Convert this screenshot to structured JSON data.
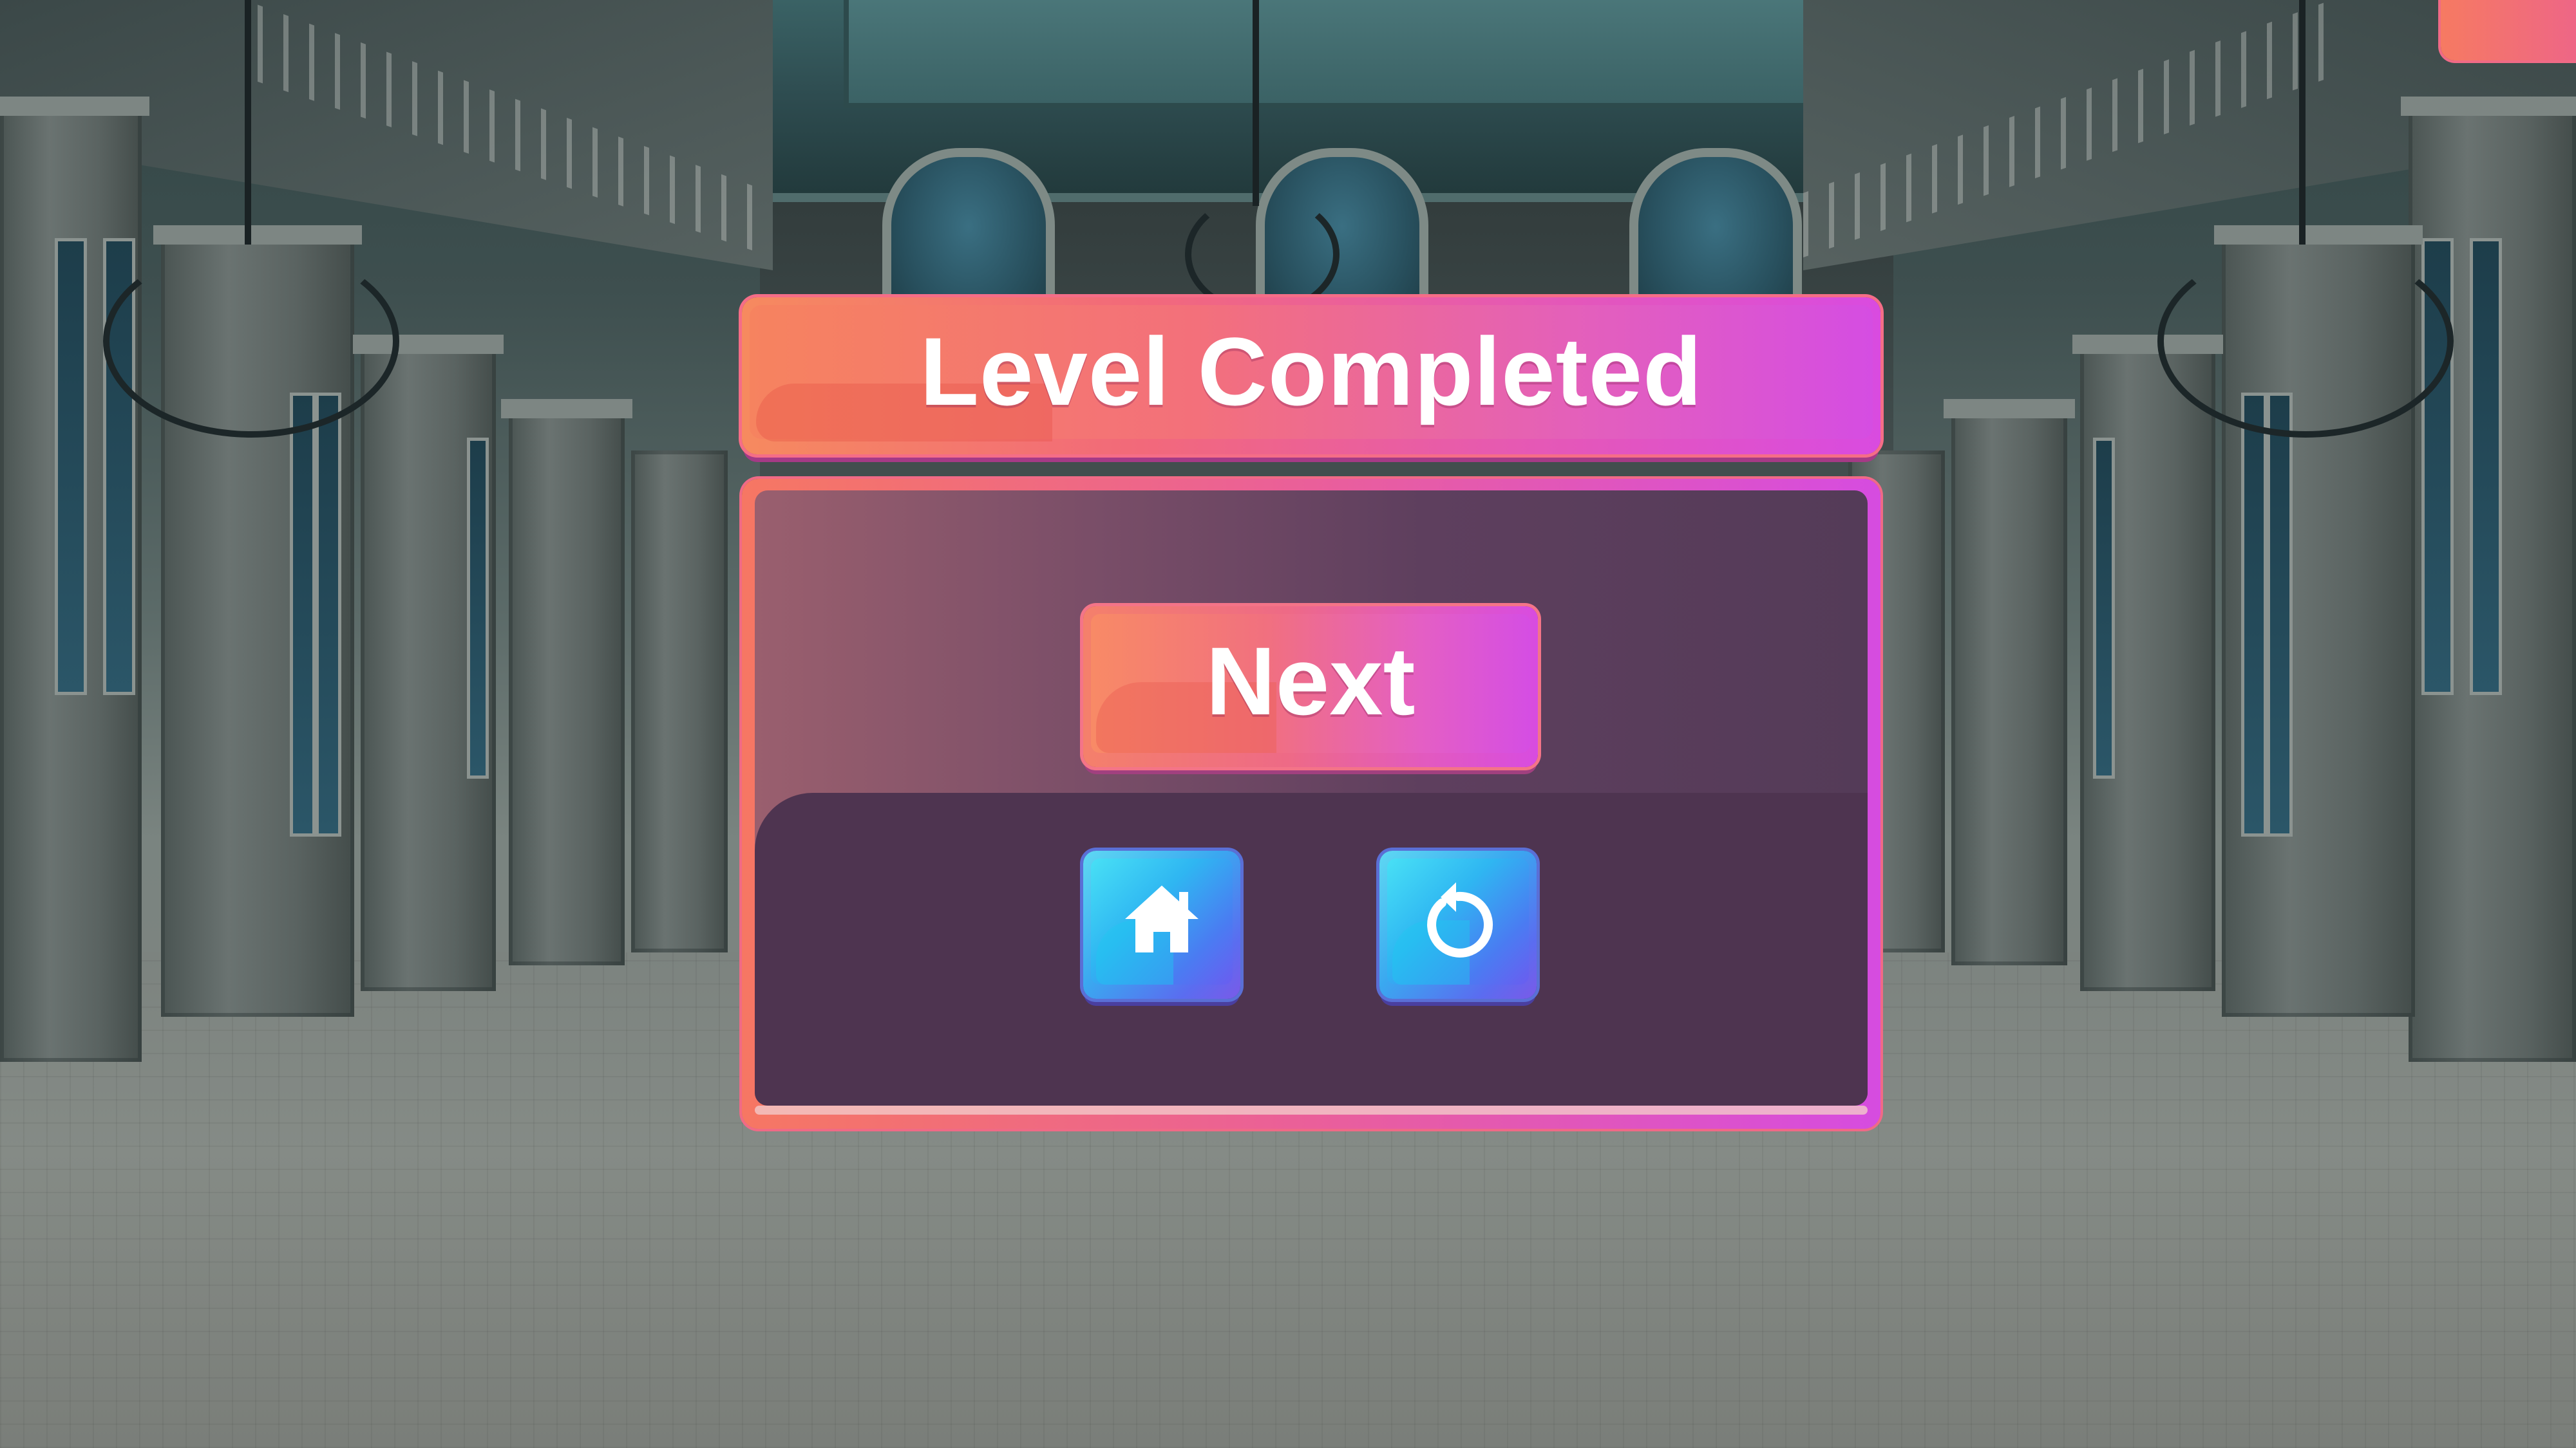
{
  "dialog": {
    "title": "Level Completed",
    "next_label": "Next",
    "home_icon": "home-icon",
    "restart_icon": "restart-icon"
  },
  "colors": {
    "banner_start": "#f68a5f",
    "banner_end": "#d94be0",
    "panel_dark": "#4e3450",
    "icon_button_start": "#5ed8f3",
    "icon_button_end": "#7a5ae8",
    "text": "#ffffff"
  }
}
